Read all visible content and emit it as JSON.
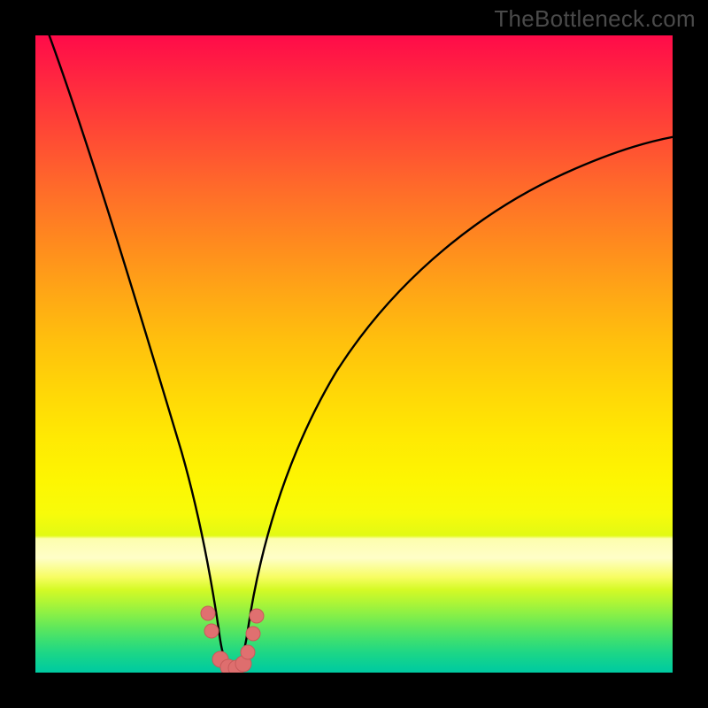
{
  "watermark": "TheBottleneck.com",
  "colors": {
    "frame": "#000000",
    "curve": "#000000",
    "marker_fill": "#e07070",
    "marker_stroke": "#c85a5a"
  },
  "chart_data": {
    "type": "line",
    "title": "",
    "xlabel": "",
    "ylabel": "",
    "xlim": [
      0,
      100
    ],
    "ylim": [
      0,
      100
    ],
    "grid": false,
    "legend": false,
    "background": "gradient red-orange-yellow-green (top-to-bottom)",
    "series": [
      {
        "name": "left-branch",
        "x": [
          2,
          6,
          10,
          14,
          18,
          22,
          24,
          26,
          27,
          28,
          29
        ],
        "y": [
          100,
          86,
          72,
          58,
          44,
          30,
          22,
          14,
          9,
          5,
          2
        ]
      },
      {
        "name": "right-branch",
        "x": [
          33,
          34,
          36,
          40,
          46,
          54,
          62,
          70,
          78,
          86,
          94,
          100
        ],
        "y": [
          2,
          5,
          11,
          22,
          35,
          48,
          58,
          66,
          72,
          77,
          81,
          84
        ]
      },
      {
        "name": "valley-floor",
        "x": [
          29,
          30,
          31,
          32,
          33
        ],
        "y": [
          2,
          0.6,
          0.3,
          0.6,
          2
        ]
      }
    ],
    "markers": [
      {
        "x": 27.1,
        "y": 9.2
      },
      {
        "x": 27.7,
        "y": 6.4
      },
      {
        "x": 29.0,
        "y": 2.0
      },
      {
        "x": 30.2,
        "y": 0.7
      },
      {
        "x": 31.4,
        "y": 0.6
      },
      {
        "x": 32.6,
        "y": 1.3
      },
      {
        "x": 33.4,
        "y": 3.0
      },
      {
        "x": 34.2,
        "y": 6.0
      },
      {
        "x": 34.8,
        "y": 8.8
      }
    ],
    "notes": "V-shaped bottleneck curve on rainbow gradient; minimum at ~x=31, y≈0. Values are percentage-of-plot coordinates (0=left/bottom, 100=right/top) estimated from pixels — no numeric axes are printed."
  }
}
